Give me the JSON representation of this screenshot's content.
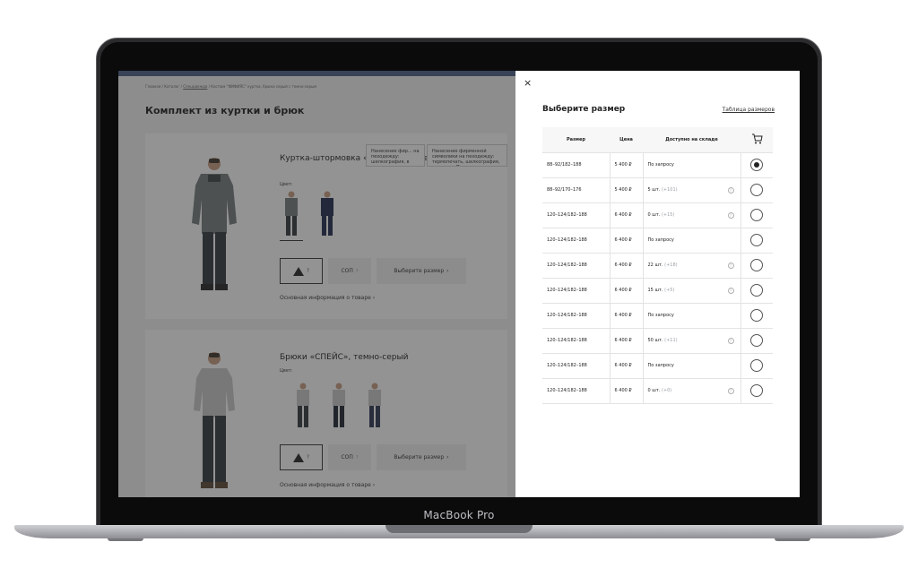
{
  "device": {
    "brand_label": "MacBook Pro"
  },
  "breadcrumbs": {
    "home": "Главная",
    "catalog": "Каталог",
    "category": "Спецодежда",
    "current": "Костюм \"ФИФИЯС\" куртка, брюки серый с темно-серым"
  },
  "main": {
    "page_title": "Комплект из куртки и брюк",
    "product1_title": "Куртка-штормовка «Ф... серая с темно-синим",
    "product2_title": "Брюки «СПЕЙС», темно-серый",
    "color_label": "Цвет:",
    "sop_label": "СОП",
    "choose_size_label": "Выберите размер",
    "info_link": "Основная информация о товаре",
    "tooltip1": "Нанесение фир... на пеходежду: шелкография, в",
    "tooltip2": "Нанесение фирменной символики на пеходежду: термопечать, шелкография, вышивка. Подр"
  },
  "panel": {
    "close_icon": "close-icon",
    "title": "Выберите размер",
    "size_table_link": "Таблица размеров",
    "headers": {
      "size": "Размер",
      "price": "Цена",
      "availability": "Доступно на складе",
      "cart_icon": "cart-icon"
    },
    "rows": [
      {
        "size": "88–92/182–188",
        "price": "5 400 ₽",
        "avail": "По запросу",
        "extra": "",
        "help": false,
        "selected": true
      },
      {
        "size": "88–92/170–176",
        "price": "5 400 ₽",
        "avail": "5 шт.",
        "extra": "(+101)",
        "help": true,
        "selected": false
      },
      {
        "size": "120–124/182–188",
        "price": "6 400 ₽",
        "avail": "0 шт.",
        "extra": "(+15)",
        "help": true,
        "selected": false
      },
      {
        "size": "120–124/182–188",
        "price": "6 400 ₽",
        "avail": "По запросу",
        "extra": "",
        "help": false,
        "selected": false
      },
      {
        "size": "120–124/182–188",
        "price": "6 400 ₽",
        "avail": "22 шт.",
        "extra": "(+18)",
        "help": true,
        "selected": false
      },
      {
        "size": "120–124/182–188",
        "price": "6 400 ₽",
        "avail": "15 шт.",
        "extra": "(+5)",
        "help": true,
        "selected": false
      },
      {
        "size": "120–124/182–188",
        "price": "6 400 ₽",
        "avail": "По запросу",
        "extra": "",
        "help": false,
        "selected": false
      },
      {
        "size": "120–124/182–188",
        "price": "6 400 ₽",
        "avail": "50 шт.",
        "extra": "(+11)",
        "help": true,
        "selected": false
      },
      {
        "size": "120–124/182–188",
        "price": "6 400 ₽",
        "avail": "По запросу",
        "extra": "",
        "help": false,
        "selected": false
      },
      {
        "size": "120–124/182–188",
        "price": "6 400 ₽",
        "avail": "0 шт.",
        "extra": "(+0)",
        "help": true,
        "selected": false
      }
    ]
  }
}
